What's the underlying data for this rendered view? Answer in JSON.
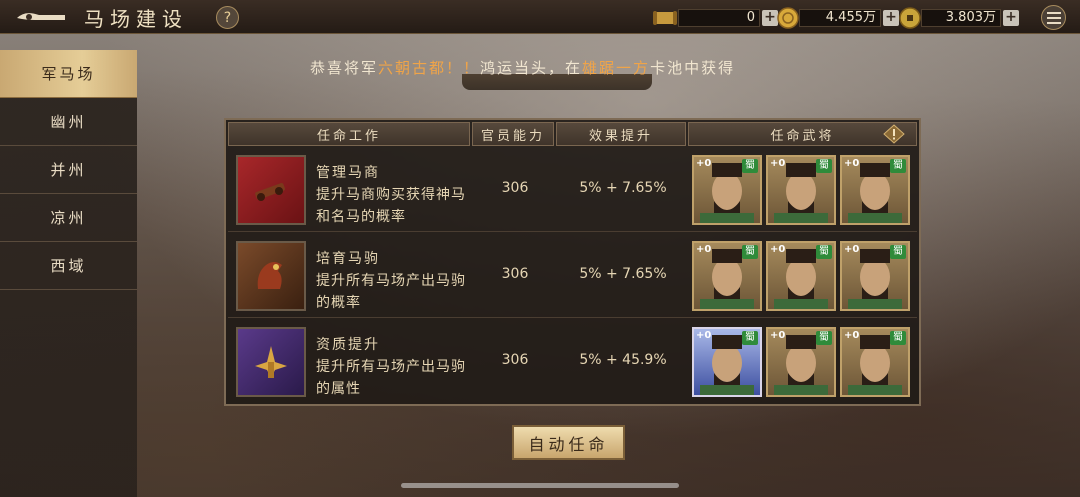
{
  "header": {
    "title": "马场建设",
    "help_label": "?",
    "resources": [
      {
        "icon": "scroll-icon",
        "value": "0"
      },
      {
        "icon": "gold-coin-icon",
        "value": "4.455万"
      },
      {
        "icon": "copper-coin-icon",
        "value": "3.803万"
      }
    ],
    "plus_label": "+"
  },
  "sidebar": {
    "items": [
      {
        "label": "军马场",
        "active": true
      },
      {
        "label": "幽州",
        "active": false
      },
      {
        "label": "并州",
        "active": false
      },
      {
        "label": "凉州",
        "active": false
      },
      {
        "label": "西域",
        "active": false
      }
    ]
  },
  "marquee": {
    "prefix": "恭喜将军",
    "player": "六朝古都！！",
    "middle": "鸿运当头，在",
    "pool": "雄踞一方",
    "suffix": "卡池中获得"
  },
  "table": {
    "headers": [
      "任命工作",
      "官员能力",
      "效果提升",
      "任命武将"
    ],
    "rows": [
      {
        "name": "管理马商",
        "desc": "提升马商购买获得神马和名马的概率",
        "ability": "306",
        "effect": "5% + 7.65%",
        "generals": [
          {
            "level": "+0",
            "faction": "蜀"
          },
          {
            "level": "+0",
            "faction": "蜀"
          },
          {
            "level": "+0",
            "faction": "蜀"
          }
        ]
      },
      {
        "name": "培育马驹",
        "desc": "提升所有马场产出马驹的概率",
        "ability": "306",
        "effect": "5% + 7.65%",
        "generals": [
          {
            "level": "+0",
            "faction": "蜀"
          },
          {
            "level": "+0",
            "faction": "蜀"
          },
          {
            "level": "+0",
            "faction": "蜀"
          }
        ]
      },
      {
        "name": "资质提升",
        "desc": "提升所有马场产出马驹的属性",
        "ability": "306",
        "effect": "5% + 45.9%",
        "generals": [
          {
            "level": "+0",
            "faction": "蜀"
          },
          {
            "level": "+0",
            "faction": "蜀"
          },
          {
            "level": "+0",
            "faction": "蜀"
          }
        ]
      }
    ]
  },
  "auto_button": "自动任命"
}
